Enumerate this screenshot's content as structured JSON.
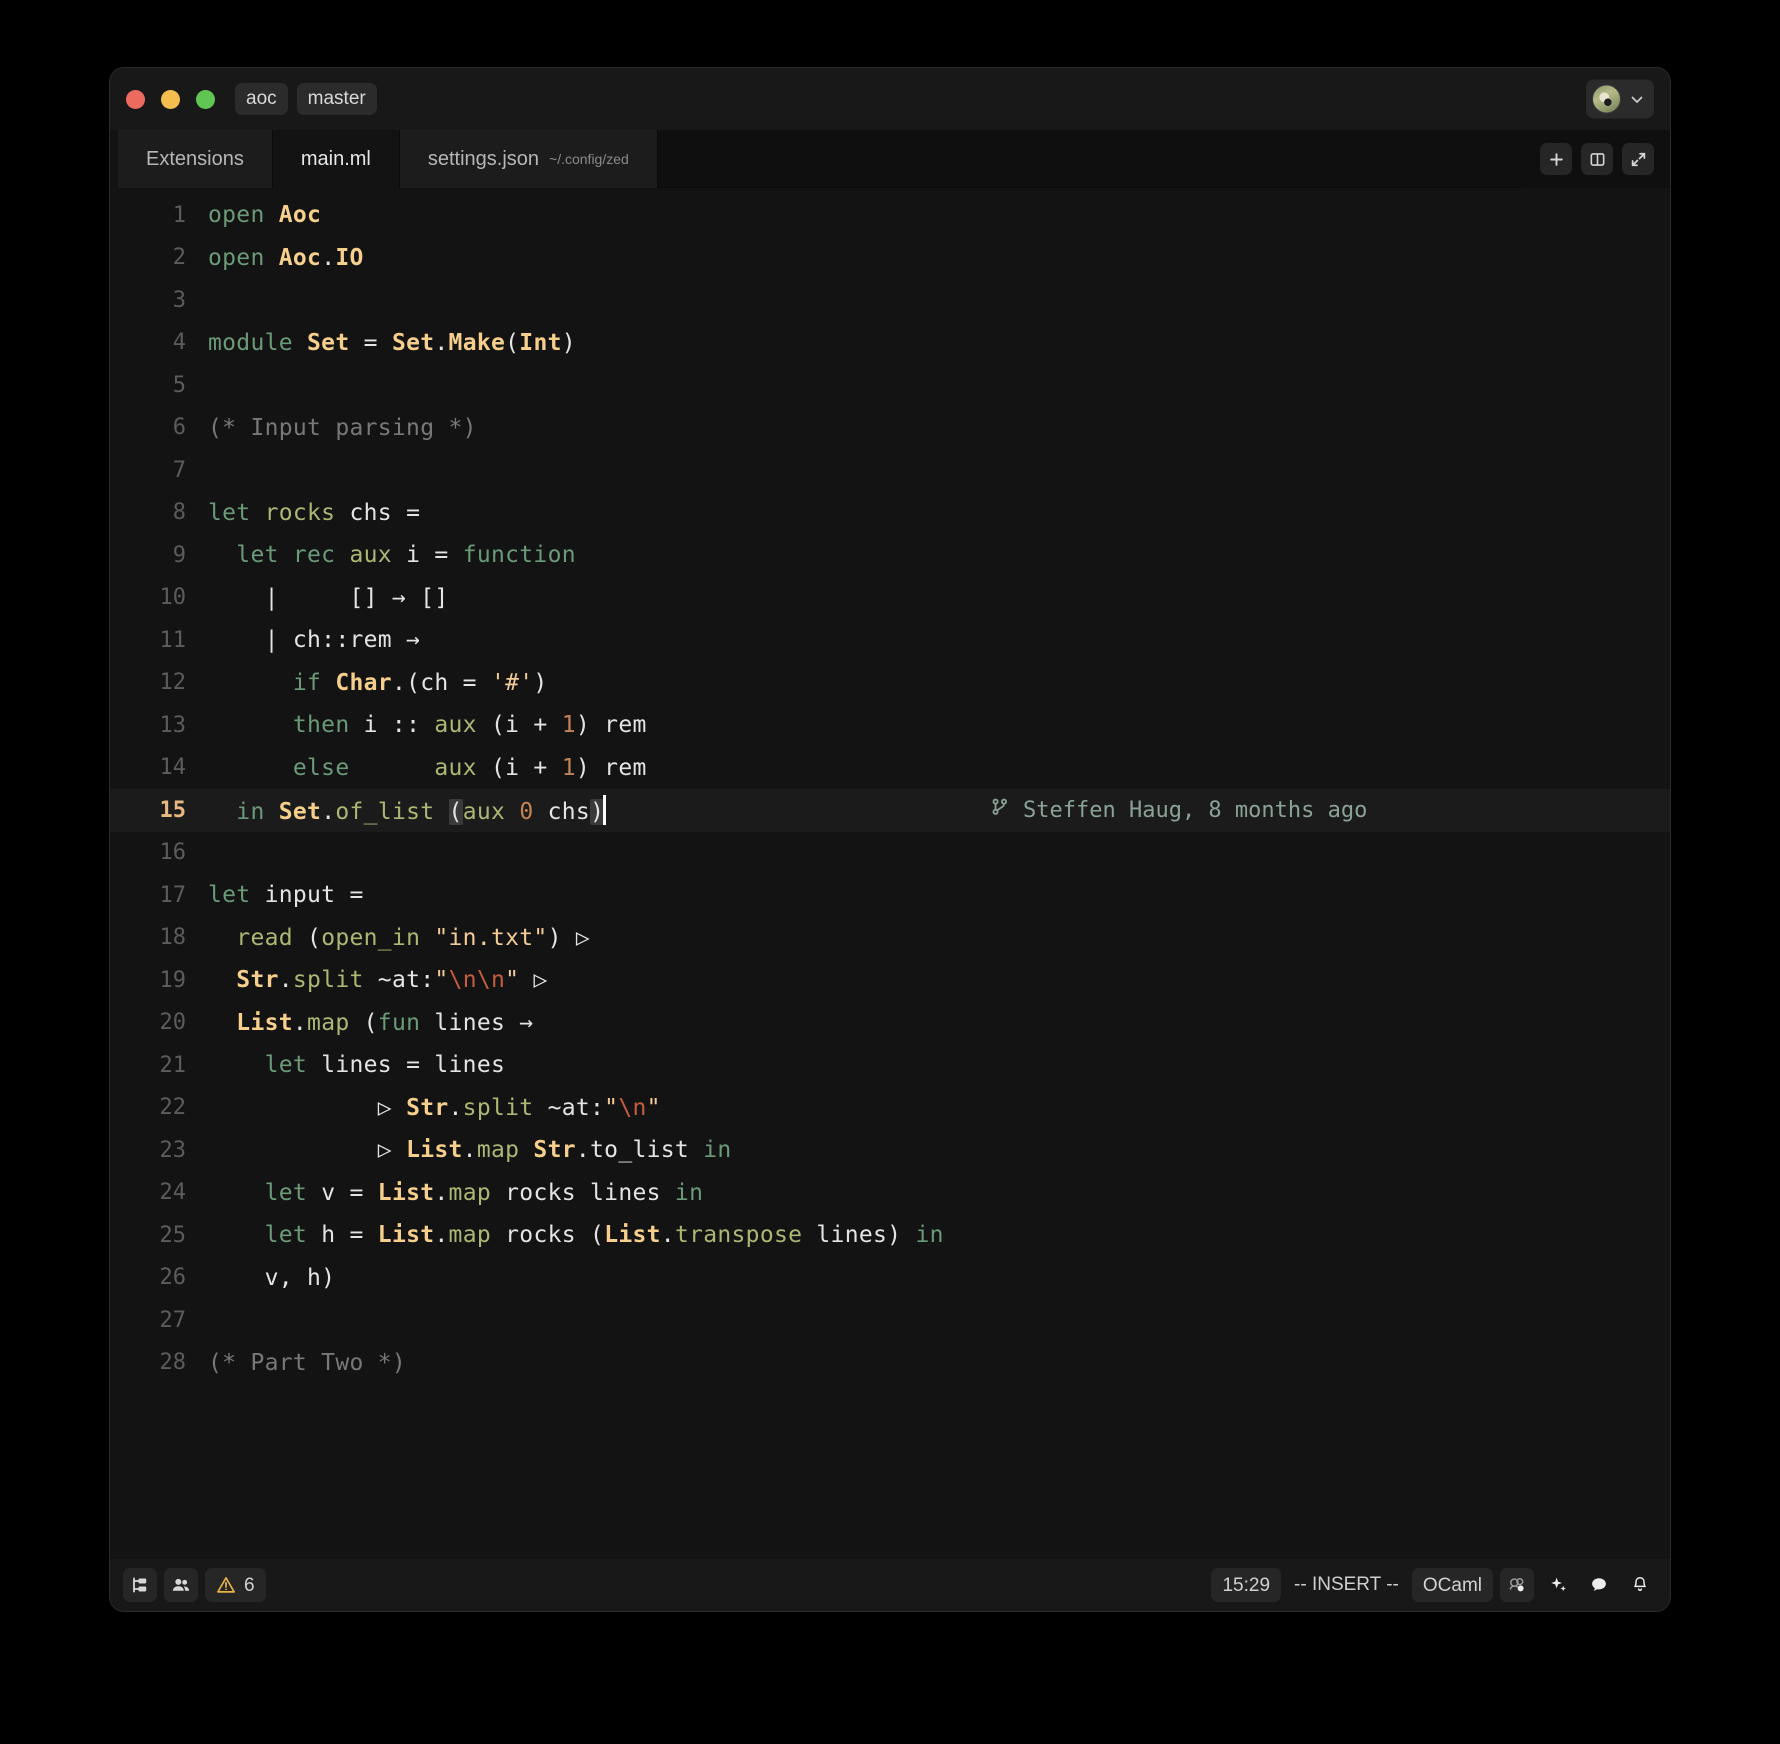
{
  "window": {
    "traffic_lights": [
      "close",
      "minimize",
      "zoom"
    ],
    "breadcrumbs": [
      {
        "label": "aoc",
        "name": "project"
      },
      {
        "label": "master",
        "name": "branch"
      }
    ],
    "user_menu": {
      "avatar_alt": "user-avatar",
      "chevron": "chevron-down-icon"
    },
    "colors": {
      "background": "#131313",
      "titlebar": "#181818",
      "tabbar": "#0f0f0f",
      "active_line": "#1b1b1b",
      "accent_orange": "#e8b882",
      "traffic_red": "#ed6a5f",
      "traffic_yellow": "#f4be4f",
      "traffic_green": "#61c554",
      "warning": "#e8b44a"
    }
  },
  "tabs": [
    {
      "label": "Extensions",
      "subpath": "",
      "active": false
    },
    {
      "label": "main.ml",
      "subpath": "",
      "active": true
    },
    {
      "label": "settings.json",
      "subpath": "~/.config/zed",
      "active": false
    }
  ],
  "tab_actions": [
    {
      "name": "new-tab-button",
      "icon": "plus-icon"
    },
    {
      "name": "split-pane-button",
      "icon": "split-pane-icon"
    },
    {
      "name": "toggle-zoom-button",
      "icon": "expand-icon"
    }
  ],
  "editor": {
    "language": "OCaml",
    "active_line": 15,
    "cursor_line": 15,
    "first_visible_line": 1,
    "last_visible_line": 28,
    "blame": {
      "icon": "git-branch-icon",
      "text": "Steffen Haug, 8 months ago",
      "on_line": 15
    },
    "lines": [
      {
        "n": 1,
        "tokens": [
          {
            "t": "open ",
            "c": "kw"
          },
          {
            "t": "Aoc",
            "c": "mod"
          }
        ]
      },
      {
        "n": 2,
        "tokens": [
          {
            "t": "open ",
            "c": "kw"
          },
          {
            "t": "Aoc",
            "c": "mod"
          },
          {
            "t": ".",
            "c": "op"
          },
          {
            "t": "IO",
            "c": "mod"
          }
        ]
      },
      {
        "n": 3,
        "tokens": []
      },
      {
        "n": 4,
        "tokens": [
          {
            "t": "module ",
            "c": "kw"
          },
          {
            "t": "Set",
            "c": "mod"
          },
          {
            "t": " = ",
            "c": "op"
          },
          {
            "t": "Set",
            "c": "mod"
          },
          {
            "t": ".",
            "c": "op"
          },
          {
            "t": "Make",
            "c": "mod"
          },
          {
            "t": "(",
            "c": "op"
          },
          {
            "t": "Int",
            "c": "mod"
          },
          {
            "t": ")",
            "c": "op"
          }
        ]
      },
      {
        "n": 5,
        "tokens": []
      },
      {
        "n": 6,
        "tokens": [
          {
            "t": "(* Input parsing *)",
            "c": "com"
          }
        ]
      },
      {
        "n": 7,
        "tokens": []
      },
      {
        "n": 8,
        "tokens": [
          {
            "t": "let ",
            "c": "kw"
          },
          {
            "t": "rocks",
            "c": "fn"
          },
          {
            "t": " chs =",
            "c": "op"
          }
        ]
      },
      {
        "n": 9,
        "tokens": [
          {
            "t": "  ",
            "c": "op"
          },
          {
            "t": "let rec ",
            "c": "kw"
          },
          {
            "t": "aux",
            "c": "fn"
          },
          {
            "t": " i = ",
            "c": "op"
          },
          {
            "t": "function",
            "c": "kw"
          }
        ]
      },
      {
        "n": 10,
        "tokens": [
          {
            "t": "    |     [] → []",
            "c": "op"
          }
        ]
      },
      {
        "n": 11,
        "tokens": [
          {
            "t": "    | ch::rem →",
            "c": "op"
          }
        ]
      },
      {
        "n": 12,
        "tokens": [
          {
            "t": "      ",
            "c": "op"
          },
          {
            "t": "if ",
            "c": "kw"
          },
          {
            "t": "Char",
            "c": "mod"
          },
          {
            "t": ".(ch = ",
            "c": "op"
          },
          {
            "t": "'#'",
            "c": "str"
          },
          {
            "t": ")",
            "c": "op"
          }
        ]
      },
      {
        "n": 13,
        "tokens": [
          {
            "t": "      ",
            "c": "op"
          },
          {
            "t": "then",
            "c": "kw"
          },
          {
            "t": " i :: ",
            "c": "op"
          },
          {
            "t": "aux",
            "c": "fn"
          },
          {
            "t": " (i + ",
            "c": "op"
          },
          {
            "t": "1",
            "c": "num"
          },
          {
            "t": ") rem",
            "c": "op"
          }
        ]
      },
      {
        "n": 14,
        "tokens": [
          {
            "t": "      ",
            "c": "op"
          },
          {
            "t": "else",
            "c": "kw"
          },
          {
            "t": "      ",
            "c": "op"
          },
          {
            "t": "aux",
            "c": "fn"
          },
          {
            "t": " (i + ",
            "c": "op"
          },
          {
            "t": "1",
            "c": "num"
          },
          {
            "t": ") rem",
            "c": "op"
          }
        ]
      },
      {
        "n": 15,
        "tokens": [
          {
            "t": "  ",
            "c": "op"
          },
          {
            "t": "in ",
            "c": "kw"
          },
          {
            "t": "Set",
            "c": "mod"
          },
          {
            "t": ".",
            "c": "op"
          },
          {
            "t": "of_list",
            "c": "fn"
          },
          {
            "t": " ",
            "c": "op"
          },
          {
            "t": "(",
            "c": "op brk"
          },
          {
            "t": "aux",
            "c": "fn"
          },
          {
            "t": " ",
            "c": "op"
          },
          {
            "t": "0",
            "c": "num"
          },
          {
            "t": " chs",
            "c": "op"
          },
          {
            "t": ")",
            "c": "op brk"
          }
        ],
        "cursor": true
      },
      {
        "n": 16,
        "tokens": []
      },
      {
        "n": 17,
        "tokens": [
          {
            "t": "let ",
            "c": "kw"
          },
          {
            "t": "input",
            "c": "op"
          },
          {
            "t": " =",
            "c": "op"
          }
        ]
      },
      {
        "n": 18,
        "tokens": [
          {
            "t": "  ",
            "c": "op"
          },
          {
            "t": "read",
            "c": "fn"
          },
          {
            "t": " (",
            "c": "op"
          },
          {
            "t": "open_in",
            "c": "fn"
          },
          {
            "t": " ",
            "c": "op"
          },
          {
            "t": "\"in.txt\"",
            "c": "str"
          },
          {
            "t": ") ▷",
            "c": "op"
          }
        ]
      },
      {
        "n": 19,
        "tokens": [
          {
            "t": "  ",
            "c": "op"
          },
          {
            "t": "Str",
            "c": "mod"
          },
          {
            "t": ".",
            "c": "op"
          },
          {
            "t": "split",
            "c": "fn"
          },
          {
            "t": " ~at:",
            "c": "op"
          },
          {
            "t": "\"",
            "c": "str"
          },
          {
            "t": "\\n\\n",
            "c": "esc"
          },
          {
            "t": "\"",
            "c": "str"
          },
          {
            "t": " ▷",
            "c": "op"
          }
        ]
      },
      {
        "n": 20,
        "tokens": [
          {
            "t": "  ",
            "c": "op"
          },
          {
            "t": "List",
            "c": "mod"
          },
          {
            "t": ".",
            "c": "op"
          },
          {
            "t": "map",
            "c": "fn"
          },
          {
            "t": " (",
            "c": "op"
          },
          {
            "t": "fun",
            "c": "kw"
          },
          {
            "t": " lines →",
            "c": "op"
          }
        ]
      },
      {
        "n": 21,
        "tokens": [
          {
            "t": "    ",
            "c": "op"
          },
          {
            "t": "let",
            "c": "kw"
          },
          {
            "t": " lines = lines",
            "c": "op"
          }
        ]
      },
      {
        "n": 22,
        "tokens": [
          {
            "t": "            ▷ ",
            "c": "op"
          },
          {
            "t": "Str",
            "c": "mod"
          },
          {
            "t": ".",
            "c": "op"
          },
          {
            "t": "split",
            "c": "fn"
          },
          {
            "t": " ~at:",
            "c": "op"
          },
          {
            "t": "\"",
            "c": "str"
          },
          {
            "t": "\\n",
            "c": "esc"
          },
          {
            "t": "\"",
            "c": "str"
          }
        ]
      },
      {
        "n": 23,
        "tokens": [
          {
            "t": "            ▷ ",
            "c": "op"
          },
          {
            "t": "List",
            "c": "mod"
          },
          {
            "t": ".",
            "c": "op"
          },
          {
            "t": "map",
            "c": "fn"
          },
          {
            "t": " ",
            "c": "op"
          },
          {
            "t": "Str",
            "c": "mod"
          },
          {
            "t": ".",
            "c": "op"
          },
          {
            "t": "to_list",
            "c": "op"
          },
          {
            "t": " ",
            "c": "op"
          },
          {
            "t": "in",
            "c": "kw"
          }
        ]
      },
      {
        "n": 24,
        "tokens": [
          {
            "t": "    ",
            "c": "op"
          },
          {
            "t": "let",
            "c": "kw"
          },
          {
            "t": " v = ",
            "c": "op"
          },
          {
            "t": "List",
            "c": "mod"
          },
          {
            "t": ".",
            "c": "op"
          },
          {
            "t": "map",
            "c": "fn"
          },
          {
            "t": " rocks lines ",
            "c": "op"
          },
          {
            "t": "in",
            "c": "kw"
          }
        ]
      },
      {
        "n": 25,
        "tokens": [
          {
            "t": "    ",
            "c": "op"
          },
          {
            "t": "let",
            "c": "kw"
          },
          {
            "t": " h = ",
            "c": "op"
          },
          {
            "t": "List",
            "c": "mod"
          },
          {
            "t": ".",
            "c": "op"
          },
          {
            "t": "map",
            "c": "fn"
          },
          {
            "t": " rocks (",
            "c": "op"
          },
          {
            "t": "List",
            "c": "mod"
          },
          {
            "t": ".",
            "c": "op"
          },
          {
            "t": "transpose",
            "c": "fn"
          },
          {
            "t": " lines) ",
            "c": "op"
          },
          {
            "t": "in",
            "c": "kw"
          }
        ]
      },
      {
        "n": 26,
        "tokens": [
          {
            "t": "    v, h)",
            "c": "op"
          }
        ]
      },
      {
        "n": 27,
        "tokens": []
      },
      {
        "n": 28,
        "tokens": [
          {
            "t": "(* Part Two *)",
            "c": "com"
          }
        ]
      }
    ]
  },
  "statusbar": {
    "left": [
      {
        "name": "project-panel-button",
        "icon": "project-panel-icon"
      },
      {
        "name": "collaborators-button",
        "icon": "people-icon"
      },
      {
        "name": "diagnostics-button",
        "icon": "warning-triangle-icon",
        "label": "6"
      }
    ],
    "right": [
      {
        "name": "clock",
        "label": "15:29",
        "kind": "chip"
      },
      {
        "name": "vim-mode-indicator",
        "label": "-- INSERT --",
        "kind": "text"
      },
      {
        "name": "language-selector",
        "label": "OCaml",
        "kind": "chip"
      },
      {
        "name": "copilot-button",
        "icon": "copilot-icon",
        "kind": "icon"
      },
      {
        "name": "assistant-button",
        "icon": "sparkle-icon",
        "kind": "icon"
      },
      {
        "name": "chat-button",
        "icon": "chat-bubble-icon",
        "kind": "icon"
      },
      {
        "name": "notifications-button",
        "icon": "bell-icon",
        "kind": "icon"
      }
    ]
  }
}
